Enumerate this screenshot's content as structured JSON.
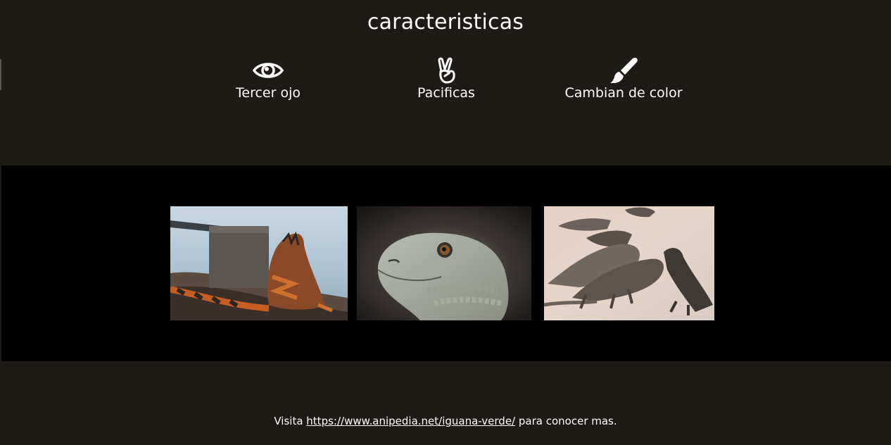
{
  "section": {
    "title": "caracteristicas"
  },
  "features": [
    {
      "label": "Tercer ojo",
      "icon": "eye-icon"
    },
    {
      "label": "Pacificas",
      "icon": "peace-hand-icon"
    },
    {
      "label": "Cambian de color",
      "icon": "paintbrush-icon"
    }
  ],
  "gallery": {
    "images": [
      {
        "subject": "iguana-on-rocks-photo"
      },
      {
        "subject": "iguana-head-closeup-photo"
      },
      {
        "subject": "iguanas-on-beach-photo"
      }
    ]
  },
  "footer": {
    "prefix": "Visita",
    "link_text": "https://www.anipedia.net/iguana-verde/",
    "suffix": "para conocer mas."
  },
  "colors": {
    "background": "#1e1a16",
    "gallery_background": "#000000",
    "text": "#ffffff"
  }
}
